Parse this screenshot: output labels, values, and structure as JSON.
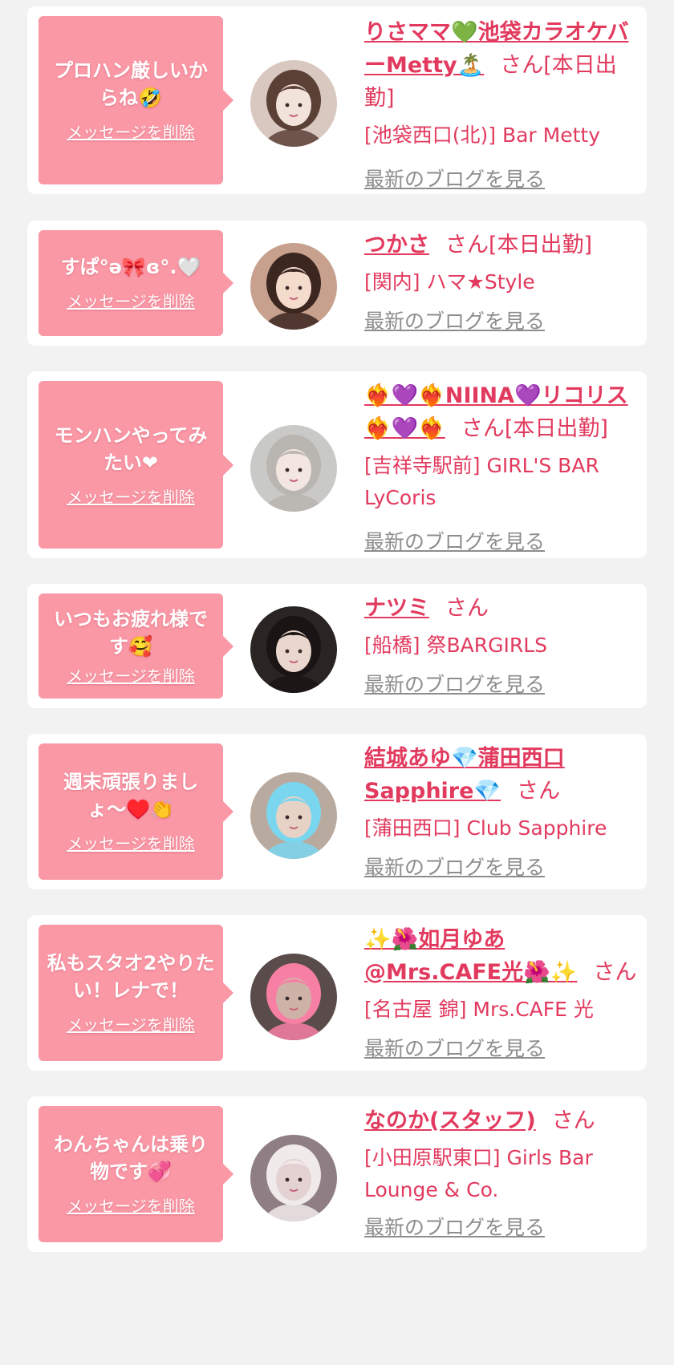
{
  "entries": [
    {
      "message": "プロハン厳しいからね🤣",
      "delete_label": "メッセージを削除",
      "name": "りさママ💚池袋カラオケバーMetty🏝️",
      "suffix": "さん[本日出勤]",
      "shop": "[池袋西口(北)] Bar Metty",
      "blog_link": "最新のブログを見る",
      "avatar_icon": "girl-portrait-avatar",
      "avatar_colors": [
        "#d9c8bf",
        "#f1e2da",
        "#5b4036"
      ]
    },
    {
      "message": "すぱ°ə🎀ɞ°.🤍",
      "delete_label": "メッセージを削除",
      "name": "つかさ",
      "suffix": "さん[本日出勤]",
      "shop": "[関内] ハマ★Style",
      "blog_link": "最新のブログを見る",
      "avatar_icon": "girl-portrait-avatar",
      "avatar_colors": [
        "#c7a18e",
        "#f4dccd",
        "#3b2620"
      ]
    },
    {
      "message": "モンハンやってみたい❤",
      "delete_label": "メッセージを削除",
      "name": "❤️‍🔥💜❤️‍🔥NIINA💜リコリス❤️‍🔥💜❤️‍🔥",
      "suffix": "さん[本日出勤]",
      "shop": "[吉祥寺駅前] GIRL'S BAR LyCoris",
      "blog_link": "最新のブログを見る",
      "avatar_icon": "girl-portrait-avatar",
      "avatar_colors": [
        "#c9c9c7",
        "#f3e6e1",
        "#b9b5b0"
      ]
    },
    {
      "message": "いつもお疲れ様です🥰",
      "delete_label": "メッセージを削除",
      "name": "ナツミ",
      "suffix": "さん",
      "shop": "[船橋] 祭BARGIRLS",
      "blog_link": "最新のブログを見る",
      "avatar_icon": "girl-portrait-avatar",
      "avatar_colors": [
        "#2a2422",
        "#e9d6cc",
        "#1a1514"
      ]
    },
    {
      "message": "週末頑張りましょ〜♥️👏",
      "delete_label": "メッセージを削除",
      "name": "結城あゆ💎蒲田西口Sapphire💎",
      "suffix": "さん",
      "shop": "[蒲田西口] Club Sapphire",
      "blog_link": "最新のブログを見る",
      "avatar_icon": "girl-portrait-avatar",
      "avatar_colors": [
        "#b9aaa0",
        "#e7d3c6",
        "#7ad6ee"
      ]
    },
    {
      "message": "私もスタオ2やりたい！レナで！",
      "delete_label": "メッセージを削除",
      "name": "✨🌺如月ゆあ@Mrs.CAFE光🌺✨",
      "suffix": "さん",
      "shop": "[名古屋 錦] Mrs.CAFE 光",
      "blog_link": "最新のブログを見る",
      "avatar_icon": "girl-portrait-avatar",
      "avatar_colors": [
        "#5a4c4a",
        "#cfb2a7",
        "#f77fa4"
      ]
    },
    {
      "message": "わんちゃんは乗り物です💞",
      "delete_label": "メッセージを削除",
      "name": "なのか(スタッフ)",
      "suffix": "さん",
      "shop": "[小田原駅東口] Girls Bar Lounge & Co.",
      "blog_link": "最新のブログを見る",
      "avatar_icon": "girl-portrait-avatar",
      "avatar_colors": [
        "#8f7f84",
        "#e4d2d3",
        "#f1eaea"
      ]
    }
  ]
}
